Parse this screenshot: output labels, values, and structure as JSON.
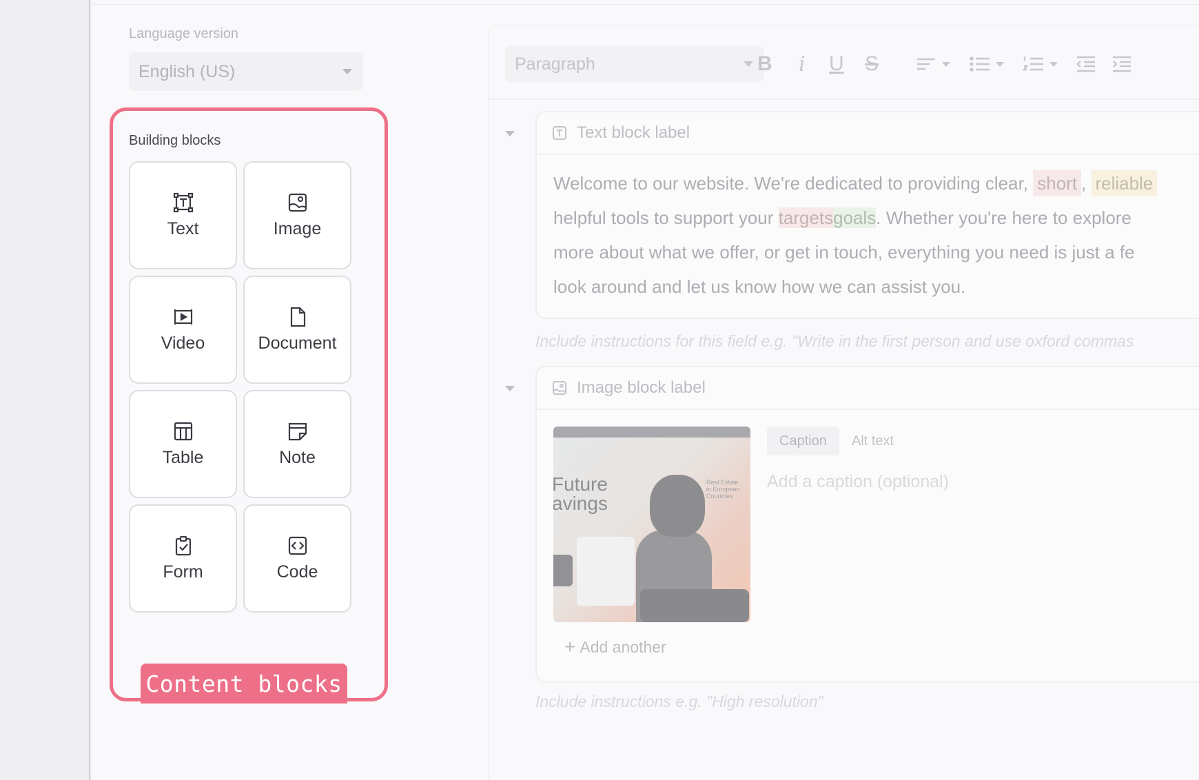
{
  "sidebar": {
    "language_label": "Language version",
    "language_value": "English (US)",
    "blocks_title": "Building blocks",
    "blocks": [
      {
        "label": "Text",
        "icon": "text-block-icon"
      },
      {
        "label": "Image",
        "icon": "image-icon"
      },
      {
        "label": "Video",
        "icon": "video-icon"
      },
      {
        "label": "Document",
        "icon": "document-icon"
      },
      {
        "label": "Table",
        "icon": "table-icon"
      },
      {
        "label": "Note",
        "icon": "note-icon"
      },
      {
        "label": "Form",
        "icon": "clipboard-check-icon"
      },
      {
        "label": "Code",
        "icon": "code-icon"
      }
    ],
    "annotation_tag": "Content blocks"
  },
  "toolbar": {
    "paragraph_value": "Paragraph",
    "bold": "B",
    "italic": "i",
    "underline": "U",
    "strike": "S"
  },
  "text_block": {
    "label": "Text block label",
    "line1_a": "Welcome to our website. We're dedicated to providing clear, ",
    "line1_hl1": "short",
    "line1_b": ", ",
    "line1_hl2": "reliable",
    "line2_a": "helpful tools to support your ",
    "line2_hl_red": "targets",
    "line2_hl_green": "goals",
    "line2_b": ". Whether you're here to explore",
    "line3": "more about what we offer, or get in touch, everything you need is just a fe",
    "line4": "look around and let us know how we can assist you.",
    "instructions": "Include instructions for this field e.g. \"Write in the first person and use oxford commas"
  },
  "image_block": {
    "label": "Image block label",
    "thumb_heading_1": "Future",
    "thumb_heading_2": "avings",
    "thumb_side_text_1": "Real Estate",
    "thumb_side_text_2": "in European",
    "thumb_side_text_3": "Countries",
    "tabs": [
      "Caption",
      "Alt text"
    ],
    "caption_placeholder": "Add a caption (optional)",
    "add_another": "Add another",
    "instructions": "Include instructions e.g. \"High resolution\""
  },
  "colors": {
    "accent": "#ee7088"
  }
}
